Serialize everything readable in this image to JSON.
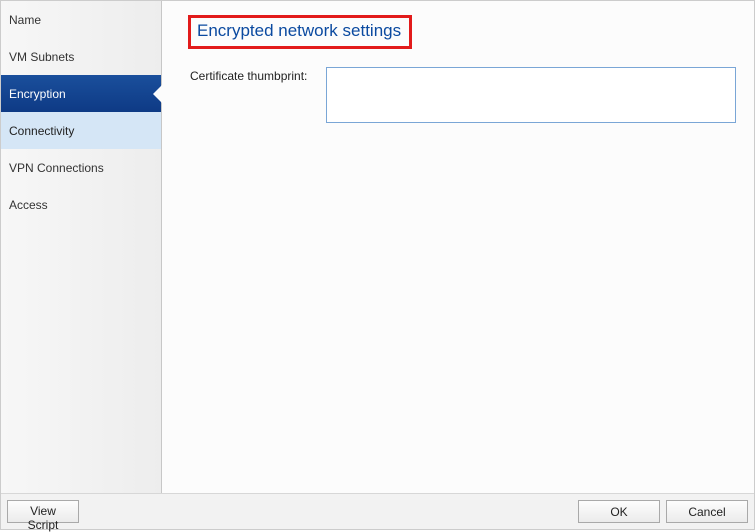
{
  "sidebar": {
    "items": [
      {
        "label": "Name"
      },
      {
        "label": "VM Subnets"
      },
      {
        "label": "Encryption"
      },
      {
        "label": "Connectivity"
      },
      {
        "label": "VPN Connections"
      },
      {
        "label": "Access"
      }
    ],
    "selected_index": 2
  },
  "main": {
    "title": "Encrypted network settings",
    "thumbprint_label": "Certificate thumbprint:",
    "thumbprint_value": ""
  },
  "buttons": {
    "view_script": "View Script",
    "ok": "OK",
    "cancel": "Cancel"
  }
}
